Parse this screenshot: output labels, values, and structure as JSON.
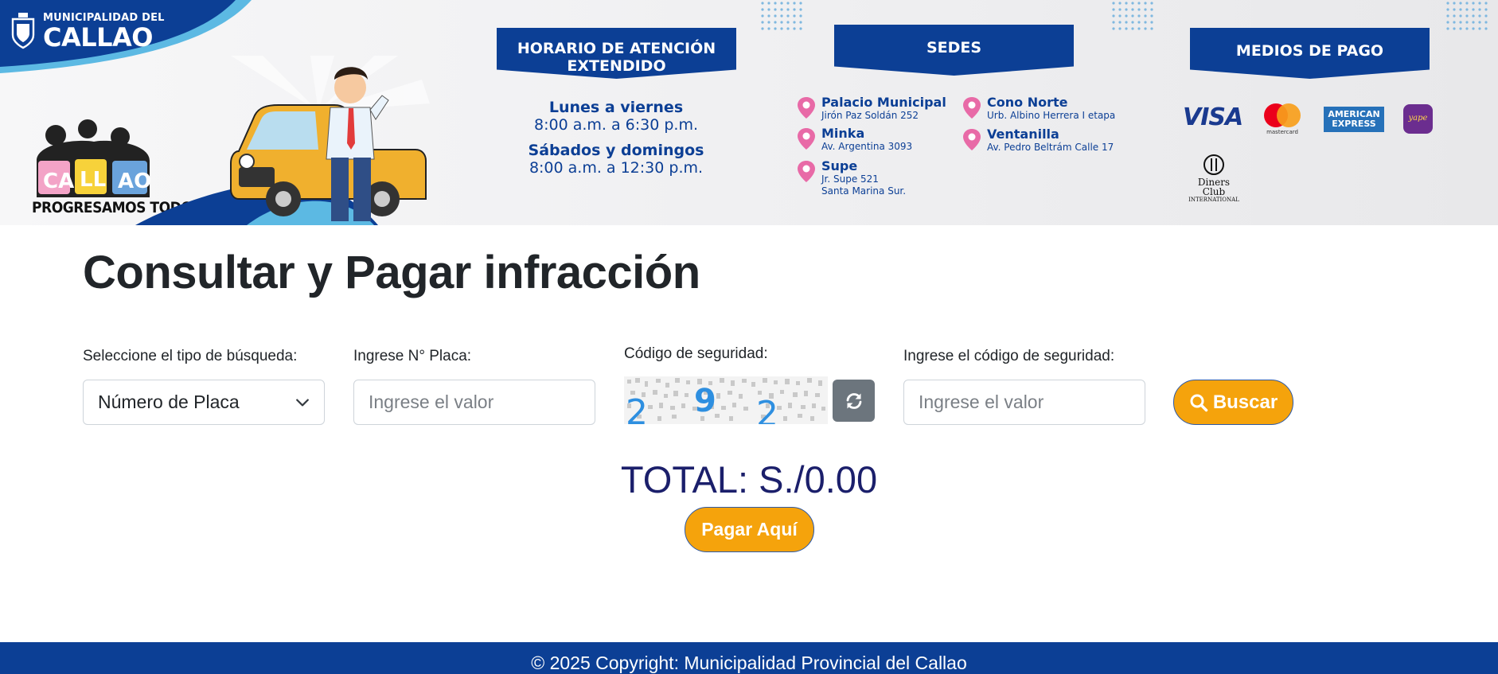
{
  "banner": {
    "logo_small": "MUNICIPALIDAD DEL",
    "logo_big": "CALLAO",
    "slogan_letters": [
      "CA",
      "LL",
      "AO"
    ],
    "slogan": "PROGRESAMOS TODOS",
    "horario": {
      "title": "HORARIO DE ATENCIÓN EXTENDIDO",
      "weekday_label": "Lunes a viernes",
      "weekday_hours": "8:00 a.m. a 6:30 p.m.",
      "weekend_label": "Sábados y domingos",
      "weekend_hours": "8:00 a.m. a 12:30 p.m."
    },
    "sedes": {
      "title": "SEDES",
      "items": [
        {
          "name": "Palacio Municipal",
          "address": "Jirón Paz Soldán 252"
        },
        {
          "name": "Minka",
          "address": "Av. Argentina 3093"
        },
        {
          "name": "Supe",
          "address": "Jr. Supe 521",
          "address2": "Santa Marina Sur."
        },
        {
          "name": "Cono Norte",
          "address": "Urb. Albino Herrera I etapa"
        },
        {
          "name": "Ventanilla",
          "address": "Av. Pedro Beltrám Calle 17"
        }
      ]
    },
    "medios": {
      "title": "MEDIOS DE PAGO",
      "visa": "VISA",
      "mastercard": "mastercard",
      "amex": "AMERICAN EXPRESS",
      "yape": "yape",
      "diners": "Diners Club",
      "diners_sub": "INTERNATIONAL"
    }
  },
  "main": {
    "title": "Consultar y Pagar infracción",
    "search_type_label": "Seleccione el tipo de búsqueda:",
    "search_type_value": "Número de Placa",
    "plate_label": "Ingrese N° Placa:",
    "plate_placeholder": "Ingrese el valor",
    "captcha_label": "Código de seguridad:",
    "captcha_chars": [
      "2",
      "9",
      "2"
    ],
    "captcha_input_label": "Ingrese el código de seguridad:",
    "captcha_placeholder": "Ingrese el valor",
    "search_button": "Buscar",
    "total": "TOTAL: S./0.00",
    "pay_button": "Pagar Aquí"
  },
  "footer": {
    "copyright": "© 2025 Copyright: Municipalidad Provincial del Callao"
  },
  "colors": {
    "primary_blue": "#0c3f95",
    "button_orange": "#f5a30c",
    "pin_pink": "#e86aa7",
    "total_navy": "#1b1f6b"
  },
  "icons": {
    "chevron": "chevron-down-icon",
    "refresh": "refresh-icon",
    "search": "search-icon",
    "pin": "map-pin-icon"
  }
}
